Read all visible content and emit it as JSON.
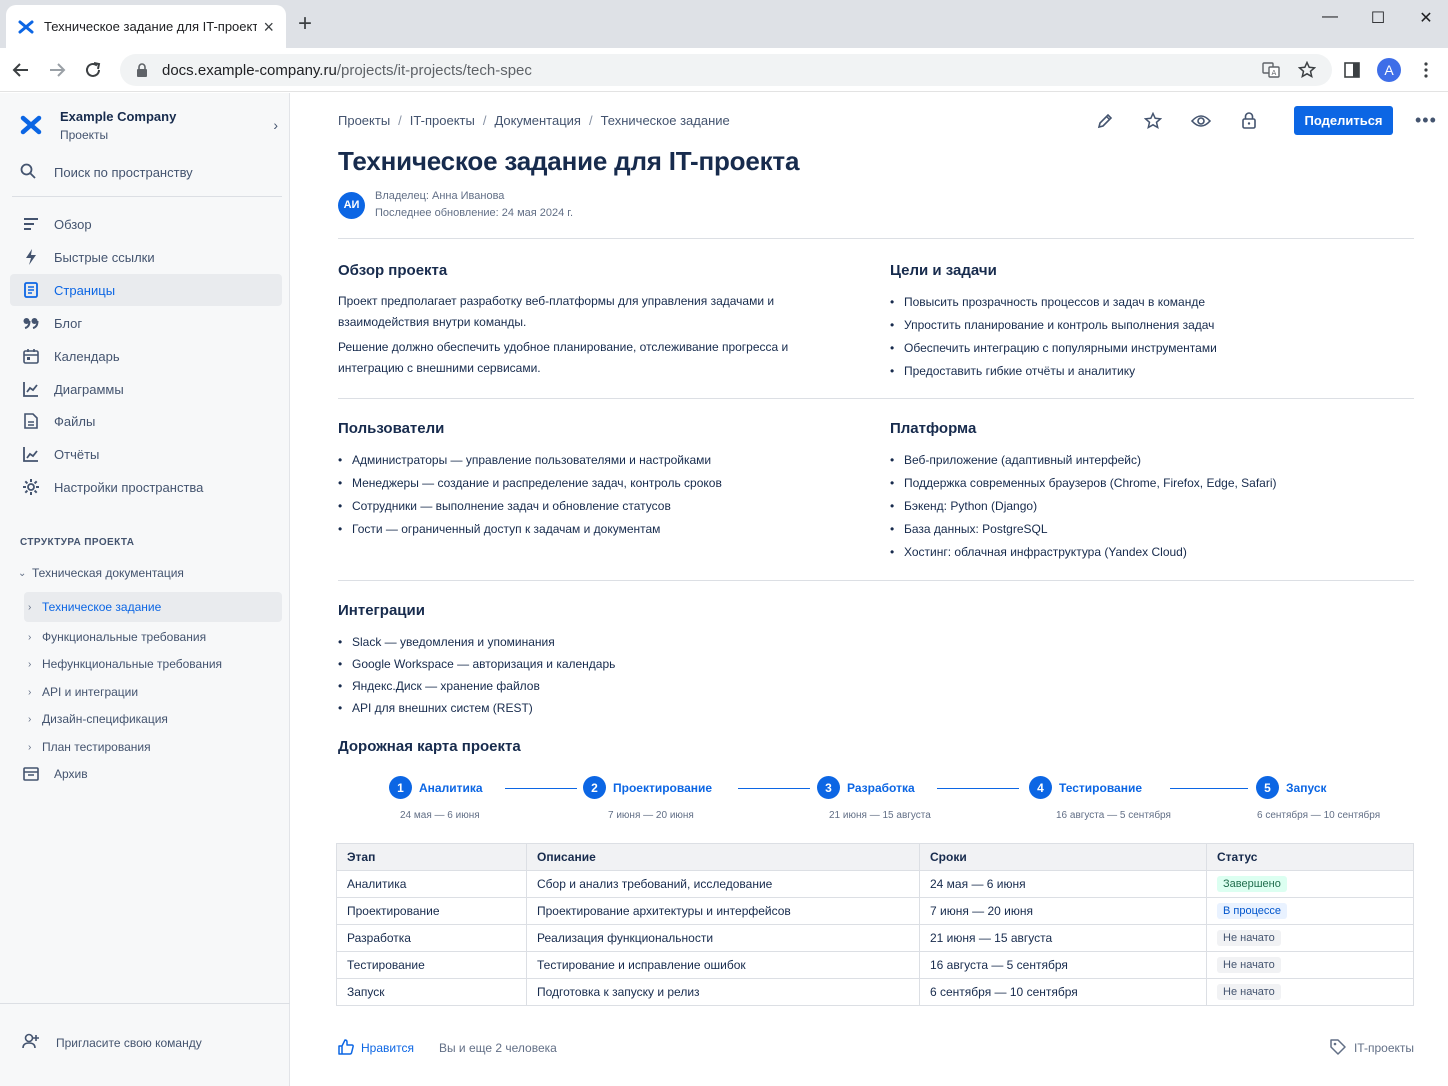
{
  "browser": {
    "tab_title": "Техническое задание для IT-проекта",
    "url_host": "docs.example-company.ru",
    "url_path": "/projects/it-projects/tech-spec",
    "profile_initial": "A"
  },
  "sidebar": {
    "company": "Example Company",
    "space": "Проекты",
    "search_label": "Поиск по пространству",
    "items": [
      {
        "label": "Обзор",
        "icon": "overview-icon"
      },
      {
        "label": "Быстрые ссылки",
        "icon": "bolt-icon"
      },
      {
        "label": "Страницы",
        "icon": "pages-icon",
        "active": true
      },
      {
        "label": "Блог",
        "icon": "quote-icon"
      },
      {
        "label": "Календарь",
        "icon": "calendar-icon"
      },
      {
        "label": "Диаграммы",
        "icon": "chart-icon"
      },
      {
        "label": "Файлы",
        "icon": "file-icon"
      },
      {
        "label": "Отчёты",
        "icon": "report-icon"
      },
      {
        "label": "Настройки пространства",
        "icon": "gear-icon"
      }
    ],
    "section_title": "СТРУКТУРА ПРОЕКТА",
    "tree_root": "Техническая документация",
    "tree": [
      "Техническое задание",
      "Функциональные требования",
      "Нефункциональные требования",
      "API и интеграции",
      "Дизайн-спецификация",
      "План тестирования"
    ],
    "archive": "Архив",
    "invite": "Пригласите свою команду"
  },
  "page": {
    "breadcrumb": [
      "Проекты",
      "IT-проекты",
      "Документация",
      "Техническое задание"
    ],
    "share_label": "Поделиться",
    "title": "Техническое задание для IT-проекта",
    "owner_initials": "АИ",
    "owner": "Владелец: Анна Иванова",
    "updated": "Последнее обновление: 24 мая 2024 г."
  },
  "overview": {
    "title": "Обзор проекта",
    "p1": "Проект предполагает разработку веб-платформы для управления задачами и взаимодействия внутри команды.",
    "p2": "Решение должно обеспечить удобное планирование, отслеживание прогресса и интеграцию с внешними сервисами."
  },
  "goals": {
    "title": "Цели и задачи",
    "items": [
      "Повысить прозрачность процессов и задач в команде",
      "Упростить планирование и контроль выполнения задач",
      "Обеспечить интеграцию с популярными инструментами",
      "Предоставить гибкие отчёты и аналитику"
    ]
  },
  "users": {
    "title": "Пользователи",
    "items": [
      "Администраторы — управление пользователями и настройками",
      "Менеджеры — создание и распределение задач, контроль сроков",
      "Сотрудники — выполнение задач и обновление статусов",
      "Гости — ограниченный доступ к задачам и документам"
    ]
  },
  "platform": {
    "title": "Платформа",
    "items": [
      "Веб-приложение (адаптивный интерфейс)",
      "Поддержка современных браузеров (Chrome, Firefox, Edge, Safari)",
      "Бэкенд: Python (Django)",
      "База данных: PostgreSQL",
      "Хостинг: облачная инфраструктура (Yandex Cloud)"
    ]
  },
  "integrations": {
    "title": "Интеграции",
    "items": [
      "Slack — уведомления и упоминания",
      "Google Workspace — авторизация и календарь",
      "Яндекс.Диск — хранение файлов",
      "API для внешних систем (REST)"
    ]
  },
  "roadmap": {
    "title": "Дорожная карта проекта",
    "steps": [
      {
        "num": "1",
        "label": "Аналитика",
        "dates": "24 мая — 6 июня"
      },
      {
        "num": "2",
        "label": "Проектирование",
        "dates": "7 июня — 20 июня"
      },
      {
        "num": "3",
        "label": "Разработка",
        "dates": "21 июня — 15 августа"
      },
      {
        "num": "4",
        "label": "Тестирование",
        "dates": "16 августа — 5 сентября"
      },
      {
        "num": "5",
        "label": "Запуск",
        "dates": "6 сентября — 10 сентября"
      }
    ]
  },
  "table": {
    "headers": [
      "Этап",
      "Описание",
      "Сроки",
      "Статус"
    ],
    "rows": [
      {
        "stage": "Аналитика",
        "desc": "Сбор и анализ требований, исследование",
        "dates": "24 мая — 6 июня",
        "status": "Завершено"
      },
      {
        "stage": "Проектирование",
        "desc": "Проектирование архитектуры и интерфейсов",
        "dates": "7 июня — 20 июня",
        "status": "В процессе"
      },
      {
        "stage": "Разработка",
        "desc": "Реализация функциональности",
        "dates": "21 июня — 15 августа",
        "status": "Не начато"
      },
      {
        "stage": "Тестирование",
        "desc": "Тестирование и исправление ошибок",
        "dates": "16 августа — 5 сентября",
        "status": "Не начато"
      },
      {
        "stage": "Запуск",
        "desc": "Подготовка к запуску и релиз",
        "dates": "6 сентября — 10 сентября",
        "status": "Не начато"
      }
    ]
  },
  "footer": {
    "like": "Нравится",
    "like_count": "Вы и еще 2 человека",
    "label": "IT-проекты"
  },
  "colors": {
    "accent": "#0c66e4",
    "done_bg": "#dcfff1",
    "progress_bg": "#e9f2ff",
    "todo_bg": "#f1f2f4"
  }
}
